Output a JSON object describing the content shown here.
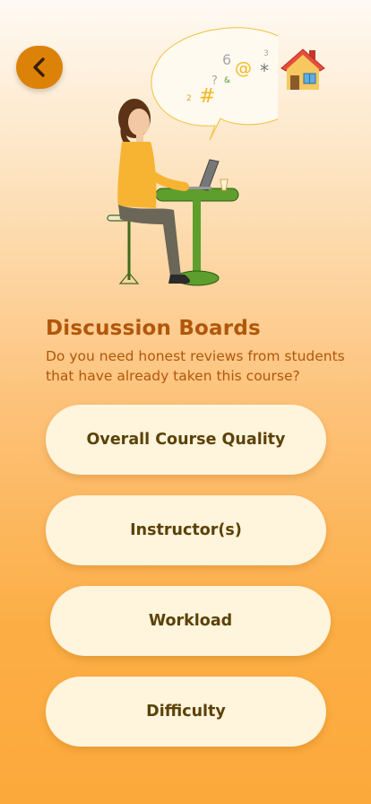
{
  "header": {
    "back_icon": "chevron-left-icon",
    "home_icon": "house-icon"
  },
  "page": {
    "title": "Discussion Boards",
    "subtitle": "Do you need honest reviews from students that have already taken this course?"
  },
  "options": [
    {
      "label": "Overall Course Quality"
    },
    {
      "label": "Instructor(s)"
    },
    {
      "label": "Workload"
    },
    {
      "label": "Difficulty"
    }
  ],
  "colors": {
    "accent": "#dd8208",
    "title": "#b1570b",
    "button_bg": "#fff4dc",
    "button_text": "#5b4208",
    "background_top": "#fefaf3",
    "background_bottom": "#fca93b"
  }
}
